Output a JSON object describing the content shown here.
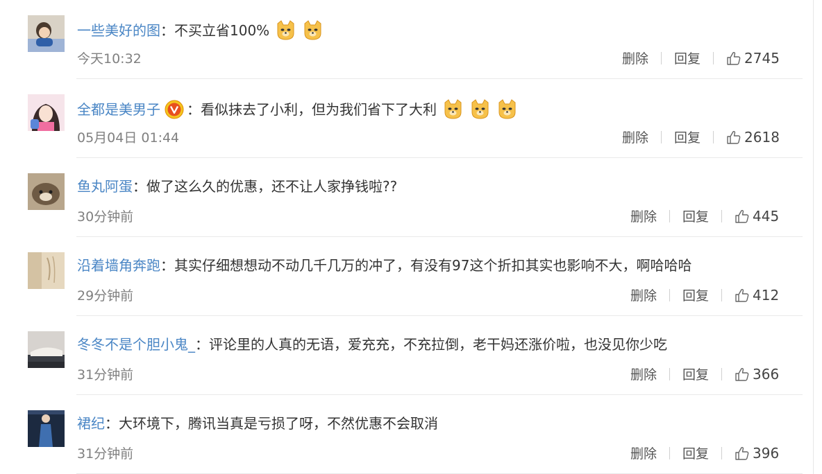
{
  "comments": [
    {
      "user": "一些美好的图",
      "text": "：不买立省100%",
      "emojis": [
        "doge-icon",
        "doge-icon"
      ],
      "time": "今天10:32",
      "delete_label": "删除",
      "reply_label": "回复",
      "likes": "2745",
      "verified": false
    },
    {
      "user": "全都是美男子",
      "text": "：看似抹去了小利，但为我们省下了大利",
      "emojis": [
        "doge-icon",
        "doge-icon",
        "doge-icon"
      ],
      "time": "05月04日 01:44",
      "delete_label": "删除",
      "reply_label": "回复",
      "likes": "2618",
      "verified": true
    },
    {
      "user": "鱼丸阿蛋",
      "text": "：做了这么久的优惠，还不让人家挣钱啦??",
      "emojis": [],
      "time": "30分钟前",
      "delete_label": "删除",
      "reply_label": "回复",
      "likes": "445",
      "verified": false
    },
    {
      "user": "沿着墙角奔跑",
      "text": "：其实仔细想想动不动几千几万的冲了，有没有97这个折扣其实也影响不大，啊哈哈哈",
      "emojis": [],
      "time": "29分钟前",
      "delete_label": "删除",
      "reply_label": "回复",
      "likes": "412",
      "verified": false
    },
    {
      "user": "冬冬不是个胆小鬼_",
      "text": "：评论里的人真的无语，爱充充，不充拉倒，老干妈还涨价啦，也没见你少吃",
      "emojis": [],
      "time": "31分钟前",
      "delete_label": "删除",
      "reply_label": "回复",
      "likes": "366",
      "verified": false
    },
    {
      "user": "裙纪",
      "text": "：大环境下，腾讯当真是亏损了呀，不然优惠不会取消",
      "emojis": [],
      "time": "31分钟前",
      "delete_label": "删除",
      "reply_label": "回复",
      "likes": "396",
      "verified": false
    }
  ],
  "colors": {
    "username": "#4a86c5",
    "text": "#333333",
    "meta": "#808080",
    "emoji": "#f6c14a"
  }
}
